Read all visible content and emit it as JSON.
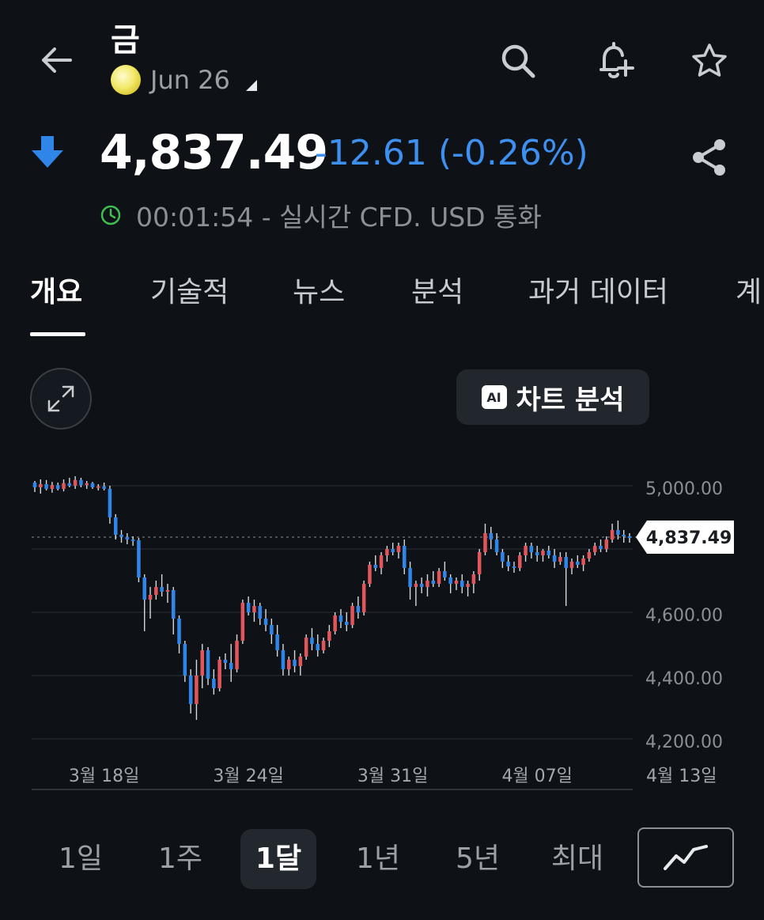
{
  "header": {
    "title": "금",
    "contract": "Jun 26",
    "price": "4,837.49",
    "change": "-12.61 (-0.26%)",
    "time_info": "00:01:54 - 실시간 CFD. USD 통화"
  },
  "tabs": [
    {
      "label": "개요",
      "active": true
    },
    {
      "label": "기술적"
    },
    {
      "label": "뉴스"
    },
    {
      "label": "분석"
    },
    {
      "label": "과거 데이터"
    },
    {
      "label": "계"
    }
  ],
  "ai_button": {
    "label": "차트 분석",
    "badge": "AI"
  },
  "ranges": [
    {
      "label": "1일"
    },
    {
      "label": "1주"
    },
    {
      "label": "1달",
      "active": true
    },
    {
      "label": "1년"
    },
    {
      "label": "5년"
    },
    {
      "label": "최대"
    }
  ],
  "colors": {
    "up": "#e0565b",
    "down": "#2f86e8",
    "accent": "#3d8ff0"
  },
  "icons": [
    "back-arrow-icon",
    "search-icon",
    "bell-plus-icon",
    "star-icon",
    "down-arrow-icon",
    "share-icon",
    "clock-icon",
    "expand-icon",
    "line-chart-icon"
  ],
  "chart_data": {
    "type": "candlestick",
    "yticks": [
      4200,
      4400,
      4600,
      5000
    ],
    "ytick_labels": [
      "4,200.00",
      "4,400.00",
      "4,600.00",
      "5,000.00"
    ],
    "ylim": [
      4150,
      5050
    ],
    "current_price": 4837.49,
    "current_label": "4,837.49",
    "xtick_labels": [
      "3월 18일",
      "3월 24일",
      "3월 31일",
      "4월 07일",
      "4월 13일"
    ],
    "xtick_index": [
      12,
      37,
      62,
      87,
      112
    ],
    "candles": [
      [
        5010,
        5015,
        4980,
        4995
      ],
      [
        4995,
        5020,
        4975,
        5005
      ],
      [
        5005,
        5018,
        4985,
        4990
      ],
      [
        4990,
        5012,
        4978,
        5002
      ],
      [
        5002,
        5010,
        4985,
        4990
      ],
      [
        4990,
        5020,
        4982,
        5008
      ],
      [
        5008,
        5025,
        4995,
        5000
      ],
      [
        5000,
        5030,
        4990,
        5018
      ],
      [
        5018,
        5025,
        4995,
        5002
      ],
      [
        5002,
        5015,
        4990,
        5008
      ],
      [
        5008,
        5012,
        4990,
        4995
      ],
      [
        4995,
        5005,
        4985,
        4998
      ],
      [
        4998,
        5010,
        4985,
        4990
      ],
      [
        4990,
        5000,
        4880,
        4900
      ],
      [
        4900,
        4910,
        4830,
        4845
      ],
      [
        4845,
        4860,
        4820,
        4838
      ],
      [
        4838,
        4850,
        4815,
        4830
      ],
      [
        4830,
        4840,
        4810,
        4828
      ],
      [
        4828,
        4835,
        4695,
        4710
      ],
      [
        4710,
        4720,
        4540,
        4640
      ],
      [
        4640,
        4680,
        4580,
        4655
      ],
      [
        4655,
        4700,
        4640,
        4680
      ],
      [
        4680,
        4720,
        4650,
        4665
      ],
      [
        4665,
        4690,
        4630,
        4670
      ],
      [
        4670,
        4680,
        4530,
        4580
      ],
      [
        4580,
        4590,
        4470,
        4500
      ],
      [
        4500,
        4510,
        4380,
        4400
      ],
      [
        4400,
        4420,
        4280,
        4310
      ],
      [
        4310,
        4450,
        4260,
        4400
      ],
      [
        4400,
        4500,
        4360,
        4480
      ],
      [
        4480,
        4490,
        4370,
        4390
      ],
      [
        4390,
        4420,
        4340,
        4360
      ],
      [
        4360,
        4460,
        4350,
        4450
      ],
      [
        4450,
        4470,
        4420,
        4440
      ],
      [
        4440,
        4500,
        4380,
        4420
      ],
      [
        4420,
        4530,
        4410,
        4510
      ],
      [
        4510,
        4640,
        4500,
        4630
      ],
      [
        4630,
        4650,
        4590,
        4600
      ],
      [
        4600,
        4640,
        4570,
        4620
      ],
      [
        4620,
        4630,
        4560,
        4580
      ],
      [
        4580,
        4610,
        4540,
        4560
      ],
      [
        4560,
        4580,
        4500,
        4530
      ],
      [
        4530,
        4560,
        4460,
        4480
      ],
      [
        4480,
        4500,
        4400,
        4420
      ],
      [
        4420,
        4460,
        4400,
        4450
      ],
      [
        4450,
        4480,
        4410,
        4430
      ],
      [
        4430,
        4470,
        4400,
        4460
      ],
      [
        4460,
        4530,
        4450,
        4520
      ],
      [
        4520,
        4550,
        4480,
        4500
      ],
      [
        4500,
        4530,
        4460,
        4480
      ],
      [
        4480,
        4520,
        4470,
        4510
      ],
      [
        4510,
        4560,
        4490,
        4540
      ],
      [
        4540,
        4600,
        4530,
        4590
      ],
      [
        4590,
        4610,
        4550,
        4570
      ],
      [
        4570,
        4600,
        4540,
        4560
      ],
      [
        4560,
        4630,
        4550,
        4620
      ],
      [
        4620,
        4650,
        4580,
        4600
      ],
      [
        4600,
        4700,
        4590,
        4690
      ],
      [
        4690,
        4760,
        4680,
        4750
      ],
      [
        4750,
        4780,
        4730,
        4740
      ],
      [
        4740,
        4790,
        4720,
        4780
      ],
      [
        4780,
        4810,
        4760,
        4800
      ],
      [
        4800,
        4820,
        4780,
        4790
      ],
      [
        4790,
        4820,
        4770,
        4810
      ],
      [
        4810,
        4830,
        4720,
        4740
      ],
      [
        4740,
        4760,
        4640,
        4680
      ],
      [
        4680,
        4700,
        4620,
        4690
      ],
      [
        4690,
        4710,
        4660,
        4680
      ],
      [
        4680,
        4720,
        4650,
        4700
      ],
      [
        4700,
        4730,
        4680,
        4690
      ],
      [
        4690,
        4740,
        4680,
        4730
      ],
      [
        4730,
        4760,
        4700,
        4710
      ],
      [
        4710,
        4720,
        4660,
        4690
      ],
      [
        4690,
        4710,
        4670,
        4700
      ],
      [
        4700,
        4720,
        4660,
        4680
      ],
      [
        4680,
        4700,
        4650,
        4690
      ],
      [
        4690,
        4730,
        4660,
        4720
      ],
      [
        4720,
        4800,
        4700,
        4790
      ],
      [
        4790,
        4880,
        4780,
        4850
      ],
      [
        4850,
        4870,
        4800,
        4830
      ],
      [
        4830,
        4850,
        4780,
        4790
      ],
      [
        4790,
        4800,
        4740,
        4760
      ],
      [
        4760,
        4780,
        4730,
        4745
      ],
      [
        4745,
        4760,
        4725,
        4740
      ],
      [
        4740,
        4790,
        4730,
        4780
      ],
      [
        4780,
        4820,
        4760,
        4810
      ],
      [
        4810,
        4820,
        4770,
        4790
      ],
      [
        4790,
        4810,
        4760,
        4780
      ],
      [
        4780,
        4800,
        4760,
        4795
      ],
      [
        4795,
        4810,
        4770,
        4780
      ],
      [
        4780,
        4800,
        4740,
        4760
      ],
      [
        4760,
        4790,
        4750,
        4775
      ],
      [
        4775,
        4790,
        4620,
        4740
      ],
      [
        4740,
        4770,
        4720,
        4760
      ],
      [
        4760,
        4780,
        4740,
        4750
      ],
      [
        4750,
        4780,
        4730,
        4770
      ],
      [
        4770,
        4800,
        4760,
        4790
      ],
      [
        4790,
        4820,
        4780,
        4810
      ],
      [
        4810,
        4830,
        4790,
        4800
      ],
      [
        4800,
        4840,
        4790,
        4830
      ],
      [
        4830,
        4880,
        4820,
        4860
      ],
      [
        4860,
        4890,
        4830,
        4845
      ],
      [
        4845,
        4860,
        4820,
        4840
      ],
      [
        4840,
        4850,
        4820,
        4837.49
      ]
    ]
  }
}
